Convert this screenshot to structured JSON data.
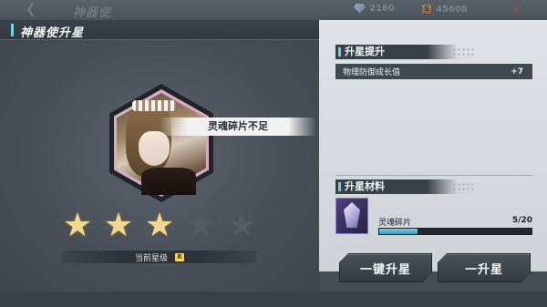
{
  "background": {
    "title": "神器使",
    "gems": "2160",
    "coins": "45608"
  },
  "header": {
    "title": "神器使升星",
    "gems": "2160",
    "coins": "45608",
    "coin_glyph": "S"
  },
  "left": {
    "tip": "灵魂碎片不足",
    "stars_filled": 3,
    "stars_total": 5,
    "current_label": "当前星级",
    "rank_badge": "R"
  },
  "right": {
    "upgrade_title": "升星提升",
    "stat_name": "物理防御成长值",
    "stat_value": "+7",
    "material_title": "升星材料",
    "material_name": "灵魂碎片",
    "material_count": "5/20",
    "material_progress": 0.25,
    "btn_one_click": "一键升星",
    "btn_single": "一升星"
  },
  "colors": {
    "accent": "#6fd4e6",
    "star_filled": "#f0d890",
    "close": "#e0574e"
  }
}
